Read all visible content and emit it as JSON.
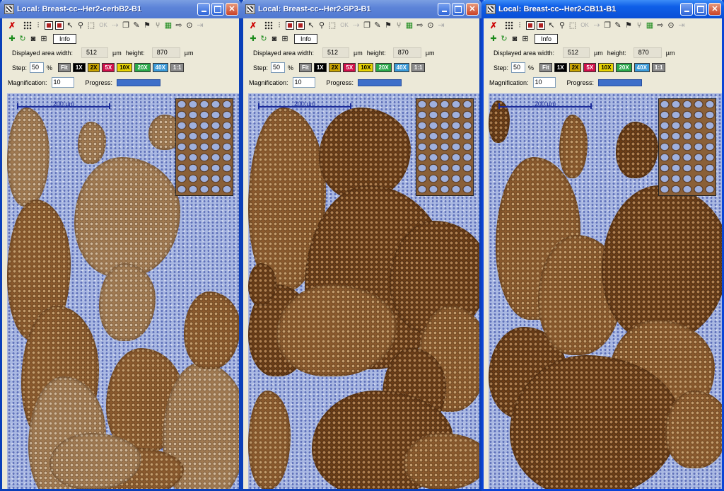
{
  "windows": [
    {
      "title": "Local: Breast-cc--Her2-cerbB2-B1",
      "info_label": "Info",
      "area_label": "Displayed area width:",
      "width_value": "512",
      "width_unit": "µm",
      "height_label": "height:",
      "height_value": "870",
      "height_unit": "µm",
      "step_label": "Step:",
      "step_value": "50",
      "step_unit": "%",
      "zoom_buttons": [
        "Fit",
        "1X",
        "2X",
        "5X",
        "10X",
        "20X",
        "40X",
        "1:1"
      ],
      "magnification_label": "Magnification:",
      "magnification_value": "10",
      "progress_label": "Progress:",
      "scale_label": "200 µm",
      "active": false
    },
    {
      "title": "Local: Breast-cc--Her2-SP3-B1",
      "info_label": "Info",
      "area_label": "Displayed area width:",
      "width_value": "512",
      "width_unit": "µm",
      "height_label": "height:",
      "height_value": "870",
      "height_unit": "µm",
      "step_label": "Step:",
      "step_value": "50",
      "step_unit": "%",
      "zoom_buttons": [
        "Fit",
        "1X",
        "2X",
        "5X",
        "10X",
        "20X",
        "40X",
        "1:1"
      ],
      "magnification_label": "Magnification:",
      "magnification_value": "10",
      "progress_label": "Progress:",
      "scale_label": "200 µm",
      "active": false
    },
    {
      "title": "Local: Breast-cc--Her2-CB11-B1",
      "info_label": "Info",
      "area_label": "Displayed area width:",
      "width_value": "512",
      "width_unit": "µm",
      "height_label": "height:",
      "height_value": "870",
      "height_unit": "µm",
      "step_label": "Step:",
      "step_value": "50",
      "step_unit": "%",
      "zoom_buttons": [
        "Fit",
        "1X",
        "2X",
        "5X",
        "10X",
        "20X",
        "40X",
        "1:1"
      ],
      "magnification_label": "Magnification:",
      "magnification_value": "10",
      "progress_label": "Progress:",
      "scale_label": "200 µm",
      "active": true
    }
  ],
  "zoom_button_colors": {
    "Fit": "#8a8a8a",
    "1X": "#000000",
    "2X": "#c9a400",
    "5X": "#d0104a",
    "10X": "#e8d400",
    "20X": "#2aa84a",
    "40X": "#3a9ad8",
    "1:1": "#8a8a8a"
  },
  "toolbar_disabled_label": "OK",
  "icons": [
    "close-x-icon",
    "grid-icon",
    "sliders-icon",
    "record-icon",
    "stop-icon",
    "pointer-icon",
    "zoom-icon",
    "select-area-icon",
    "ok-icon",
    "arrow-icon",
    "copy-icon",
    "draw-icon",
    "flag-icon",
    "branch-icon",
    "ruler-icon",
    "export-icon",
    "camera-icon",
    "network-icon"
  ],
  "progress_color": "#3e6fc9"
}
